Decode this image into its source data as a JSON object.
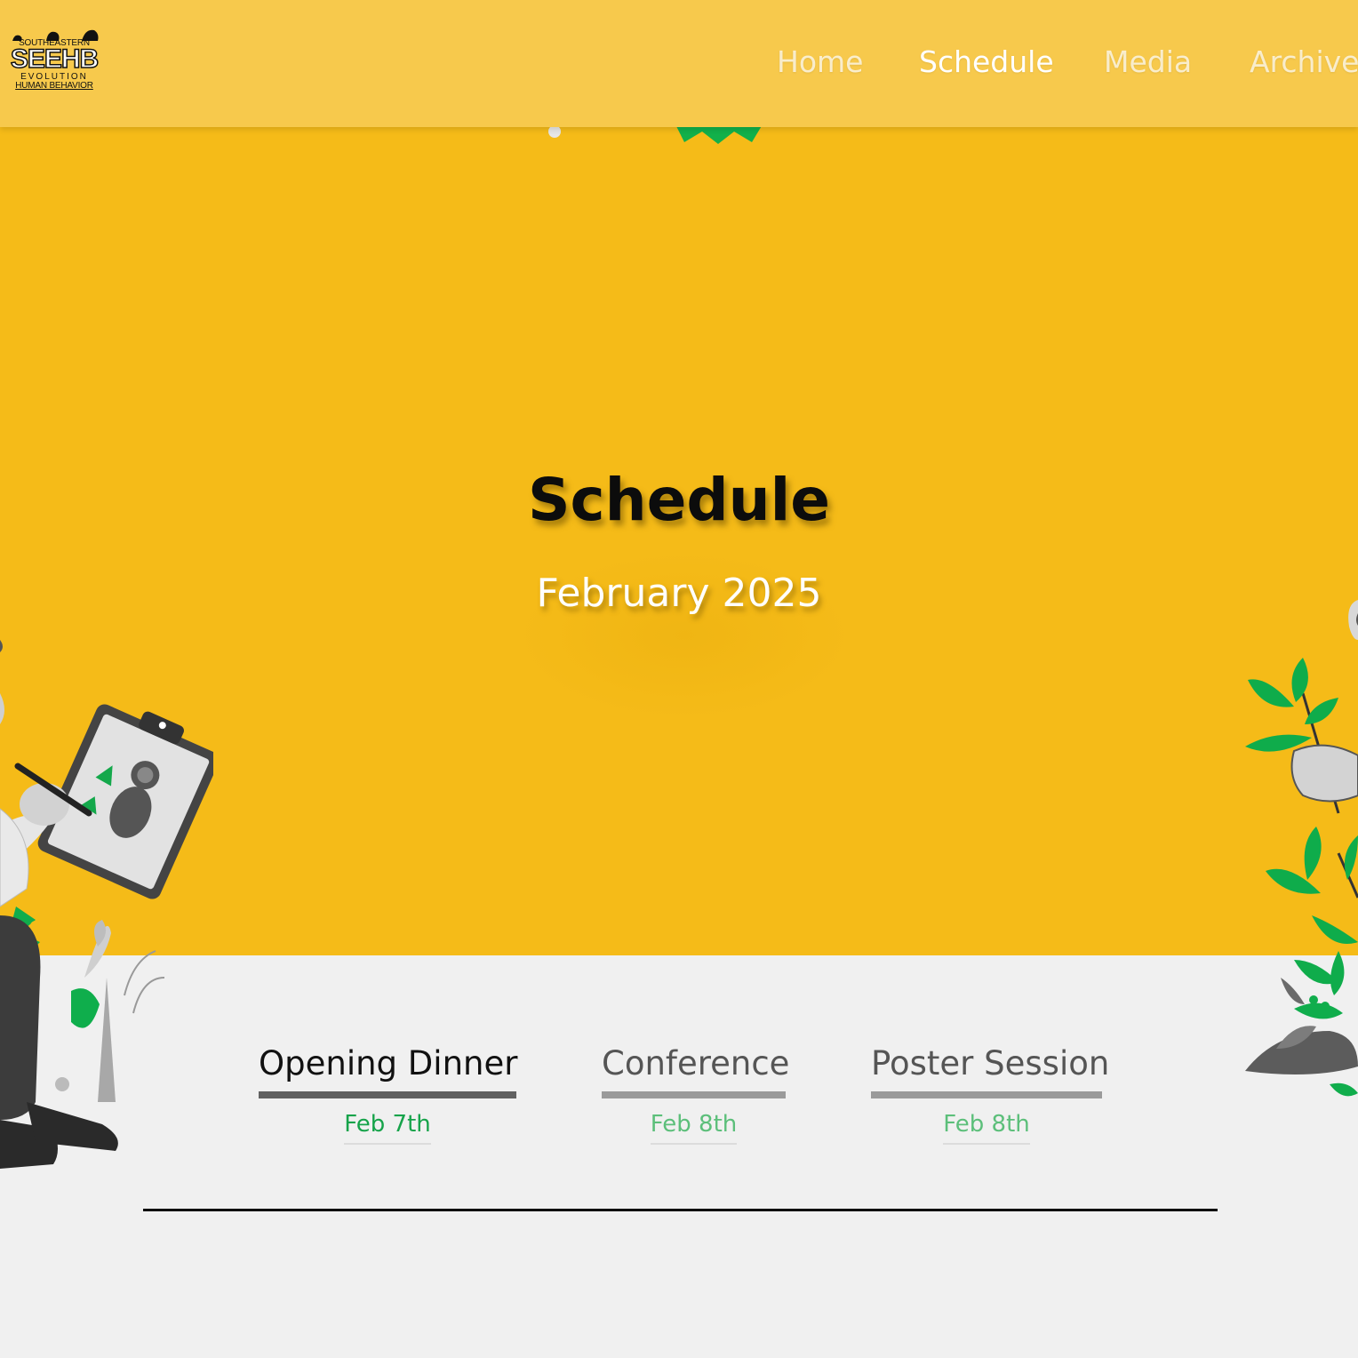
{
  "logo": {
    "top_text": "SOUTHEASTERN",
    "main_text": "SEEHB",
    "line2": "EVOLUTION",
    "line3": "HUMAN BEHAVIOR"
  },
  "nav": {
    "items": [
      {
        "label": "Home",
        "active": false
      },
      {
        "label": "Schedule",
        "active": true
      },
      {
        "label": "Media",
        "active": false
      },
      {
        "label": "Archive",
        "active": false
      }
    ]
  },
  "hero": {
    "title": "Schedule",
    "subtitle": "February 2025"
  },
  "tabs": [
    {
      "label": "Opening Dinner",
      "date": "Feb 7th",
      "active": true
    },
    {
      "label": "Conference",
      "date": "Feb 8th",
      "active": false
    },
    {
      "label": "Poster Session",
      "date": "Feb 8th",
      "active": false
    }
  ],
  "colors": {
    "hero_bg": "#f5bb18",
    "nav_bg": "#f7c94c",
    "page_bg": "#f0f0f0",
    "accent_green": "#16a34a",
    "leaf_green": "#0da84e"
  }
}
